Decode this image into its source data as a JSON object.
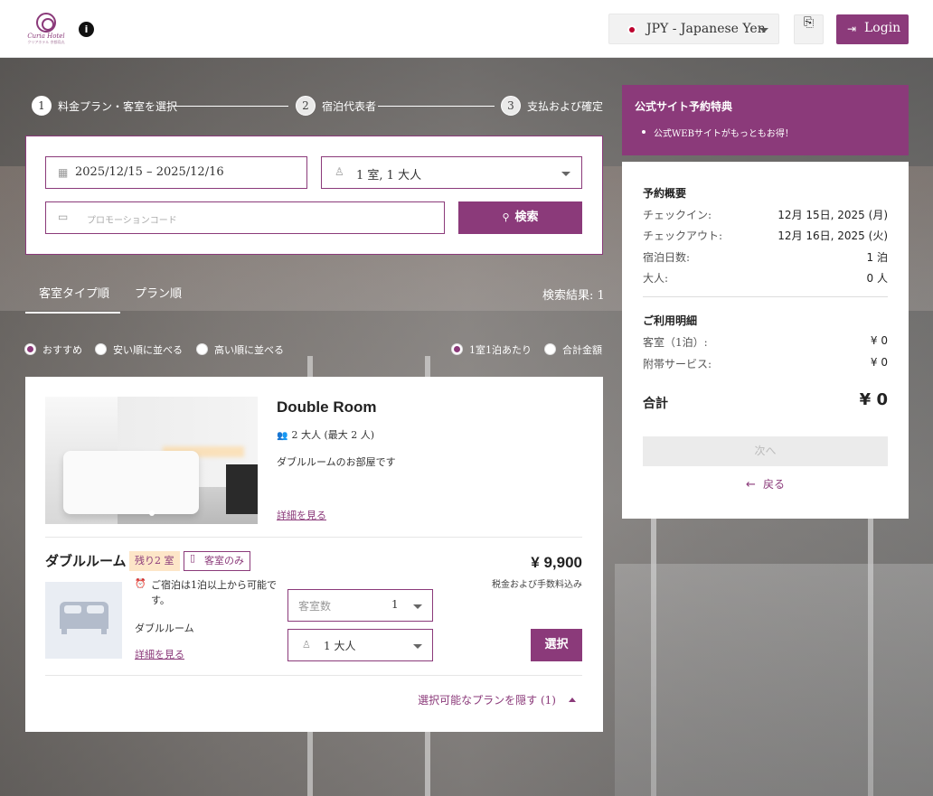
{
  "header": {
    "logo_name": "Curia Hotel",
    "logo_sub": "クリアホテル 京都烏丸",
    "currency_label": "JPY - Japanese Yen",
    "login_label": "Login"
  },
  "steps": [
    {
      "num": "1",
      "label": "料金プラン・客室を選択"
    },
    {
      "num": "2",
      "label": "宿泊代表者"
    },
    {
      "num": "3",
      "label": "支払および確定"
    }
  ],
  "search": {
    "dates": "2025/12/15 – 2025/12/16",
    "guests": "1 室, 1 大人",
    "promo_placeholder": "プロモーションコード",
    "search_label": "検索"
  },
  "tabs": {
    "room_type": "客室タイプ順",
    "plan": "プラン順",
    "result_count": "検索結果: 1"
  },
  "sort": {
    "recommended": "おすすめ",
    "cheap": "安い順に並べる",
    "expensive": "高い順に並べる",
    "per_night": "1室1泊あたり",
    "total": "合計金額"
  },
  "room": {
    "name": "Double Room",
    "occupancy": "2 大人 (最大 2 人)",
    "description": "ダブルルームのお部屋です",
    "detail_link": "詳細を見る"
  },
  "plan": {
    "name": "ダブルルーム",
    "remaining_badge": "残り2 室",
    "room_only_badge": "客室のみ",
    "min_stay": "ご宿泊は1泊以上から可能です。",
    "room_label": "ダブルルーム",
    "detail_link": "詳細を見る",
    "rooms_label": "客室数",
    "rooms_value": "1",
    "adults_value": "1 大人",
    "price": "¥ 9,900",
    "tax_note": "税金および手数料込み",
    "select_label": "選択",
    "hide_plans": "選択可能なプランを隠す (1)"
  },
  "perks": {
    "title": "公式サイト予約特典",
    "items": [
      "公式WEBサイトがもっともお得！"
    ]
  },
  "summary": {
    "overview_title": "予約概要",
    "checkin_label": "チェックイン:",
    "checkin_value": "12月 15日, 2025 (月)",
    "checkout_label": "チェックアウト:",
    "checkout_value": "12月 16日, 2025 (火)",
    "nights_label": "宿泊日数:",
    "nights_value": "1 泊",
    "adults_label": "大人:",
    "adults_value": "0 人",
    "details_title": "ご利用明細",
    "room_label": "客室（1泊）:",
    "room_value": "¥ 0",
    "service_label": "附帯サービス:",
    "service_value": "¥ 0",
    "total_label": "合計",
    "total_value": "¥ 0",
    "next_label": "次へ",
    "back_label": "戻る"
  },
  "colors": {
    "accent": "#8b3a7a",
    "badge_bg": "#fde6c8"
  }
}
